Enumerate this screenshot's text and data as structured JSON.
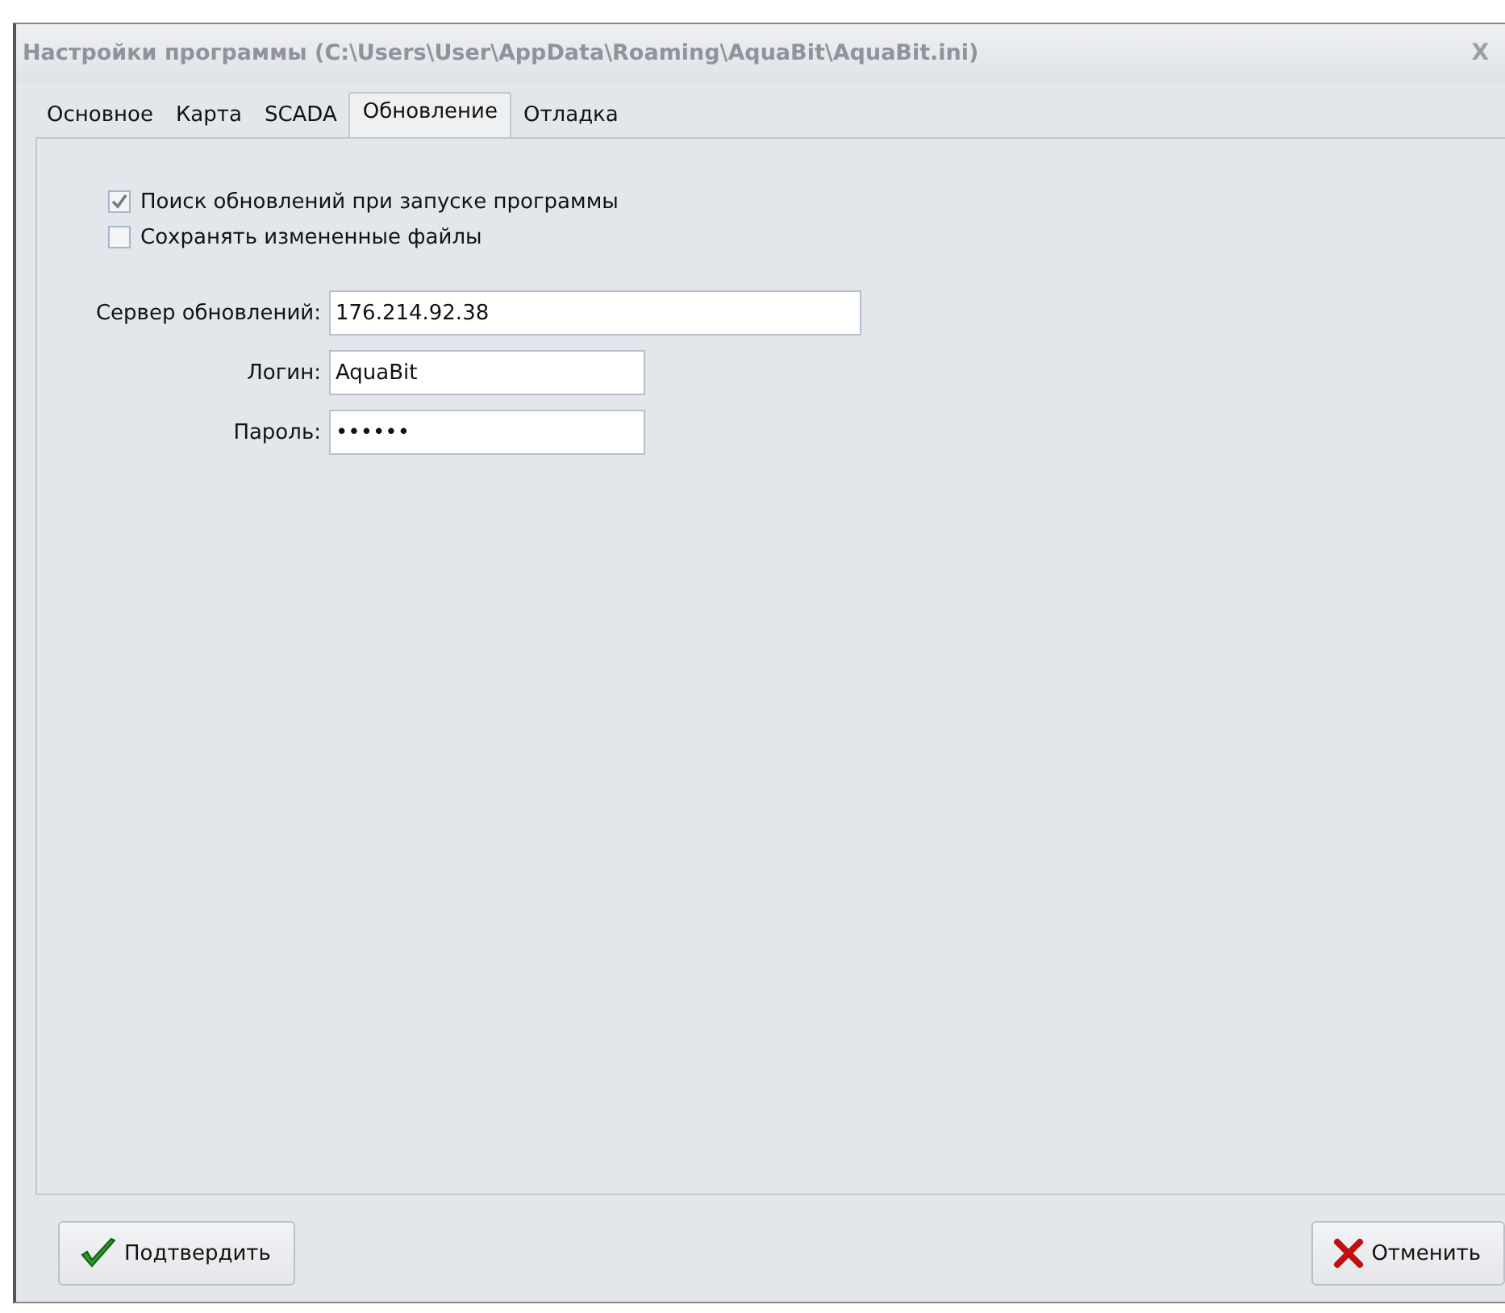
{
  "window": {
    "title": "Настройки программы (C:\\Users\\User\\AppData\\Roaming\\AquaBit\\AquaBit.ini)",
    "close": "X"
  },
  "tabs": [
    {
      "label": "Основное",
      "selected": false
    },
    {
      "label": "Карта",
      "selected": false
    },
    {
      "label": "SCADA",
      "selected": false
    },
    {
      "label": "Обновление",
      "selected": true
    },
    {
      "label": "Отладка",
      "selected": false
    }
  ],
  "checkboxes": [
    {
      "label": "Поиск обновлений при запуске программы",
      "checked": true
    },
    {
      "label": "Сохранять измененные файлы",
      "checked": false
    }
  ],
  "fields": [
    {
      "label": "Сервер обновлений:",
      "value": "176.214.92.38",
      "kind": "wide"
    },
    {
      "label": "Логин:",
      "value": "AquaBit",
      "kind": "narrow"
    },
    {
      "label": "Пароль:",
      "value": "••••••",
      "kind": "narrow"
    }
  ],
  "buttons": [
    {
      "label": "Подтвердить",
      "kind": "confirm"
    },
    {
      "label": "Отменить",
      "kind": "cancel"
    }
  ]
}
